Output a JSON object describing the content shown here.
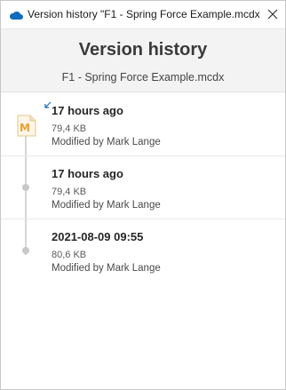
{
  "window": {
    "title": "Version history \"F1 - Spring Force Example.mcdx",
    "icons": {
      "app": "onedrive-cloud-icon",
      "close": "close-icon"
    }
  },
  "header": {
    "title": "Version history",
    "filename": "F1 - Spring Force Example.mcdx"
  },
  "versions": [
    {
      "time": "17 hours ago",
      "size": "79,4 KB",
      "modified_by": "Modified by Mark Lange",
      "current": true
    },
    {
      "time": "17 hours ago",
      "size": "79,4 KB",
      "modified_by": "Modified by Mark Lange",
      "current": false
    },
    {
      "time": "2021-08-09 09:55",
      "size": "80,6 KB",
      "modified_by": "Modified by Mark Lange",
      "current": false
    }
  ],
  "colors": {
    "accent": "#0f6cbd",
    "file_icon": "#e8a230",
    "timeline": "#d6d6d6"
  }
}
